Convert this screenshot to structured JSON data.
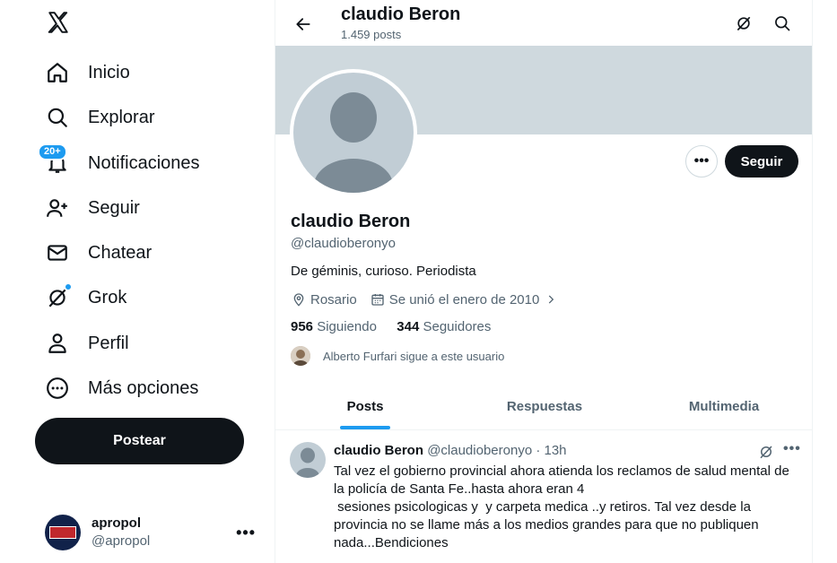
{
  "sidebar": {
    "logo": "x-logo-icon",
    "items": [
      {
        "icon": "home-icon",
        "label": "Inicio"
      },
      {
        "icon": "search-icon",
        "label": "Explorar"
      },
      {
        "icon": "bell-icon",
        "label": "Notificaciones",
        "badge": "20+"
      },
      {
        "icon": "follow-icon",
        "label": "Seguir"
      },
      {
        "icon": "mail-icon",
        "label": "Chatear"
      },
      {
        "icon": "grok-icon",
        "label": "Grok"
      },
      {
        "icon": "person-icon",
        "label": "Perfil"
      },
      {
        "icon": "more-circle-icon",
        "label": "Más opciones"
      }
    ],
    "post_button": "Postear",
    "account": {
      "name": "apropol",
      "handle": "@apropol",
      "more": "•••"
    }
  },
  "header": {
    "name": "claudio Beron",
    "post_count": "1.459 posts"
  },
  "profile": {
    "name": "claudio Beron",
    "handle": "@claudioberonyo",
    "bio": "De géminis, curioso. Periodista",
    "location": "Rosario",
    "joined": "Se unió el enero de 2010",
    "following_count": "956",
    "following_label": "Siguiendo",
    "followers_count": "344",
    "followers_label": "Seguidores",
    "followed_by": "Alberto Furfari sigue a este usuario",
    "more_button": "•••",
    "follow_button": "Seguir"
  },
  "tabs": [
    {
      "label": "Posts",
      "active": true
    },
    {
      "label": "Respuestas",
      "active": false
    },
    {
      "label": "Multimedia",
      "active": false
    }
  ],
  "tweet": {
    "name": "claudio Beron",
    "handle": "@claudioberonyo",
    "dot": "·",
    "time": "13h",
    "more": "•••",
    "text": "Tal vez el gobierno provincial ahora atienda los reclamos de salud mental de la policía de Santa Fe..hasta ahora eran 4\n sesiones psicologicas y  y carpeta medica ..y retiros. Tal vez desde la provincia no se llame más a los medios grandes para que no publiquen nada...Bendiciones"
  },
  "colors": {
    "accent": "#1d9bf0",
    "text": "#0f1419",
    "secondary": "#536471",
    "banner": "#cfd9de"
  }
}
